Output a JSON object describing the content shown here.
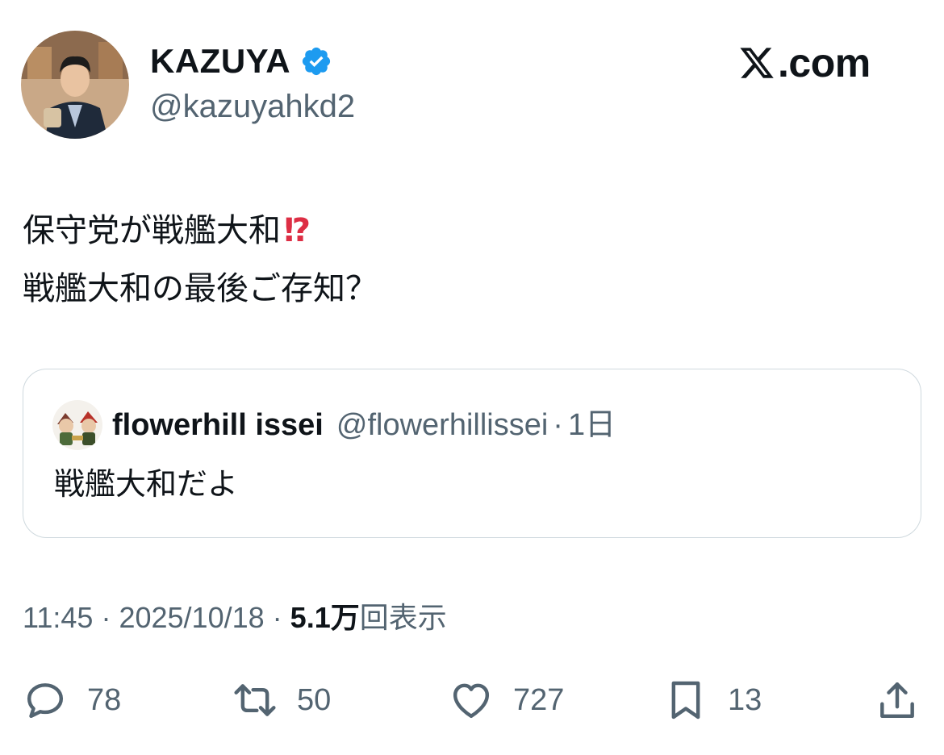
{
  "author": {
    "name": "KAZUYA",
    "handle": "@kazuyahkd2",
    "verified": true,
    "avatar_icon": "person-portrait-avatar"
  },
  "brand": {
    "logo_icon": "x-logo-icon",
    "label": ".com"
  },
  "tweet": {
    "line1": "保守党が戦艦大和",
    "line1_emoji": "⁉",
    "line2": "戦艦大和の最後ご存知？"
  },
  "quote": {
    "name": "flowerhill issei",
    "handle": "@flowerhillissei",
    "separator": "·",
    "time": "1日",
    "text": "戦艦大和だよ",
    "avatar_icon": "character-pair-avatar"
  },
  "meta": {
    "time": "11:45",
    "sep1": "·",
    "date": "2025/10/18",
    "sep2": "·",
    "views_count": "5.1万",
    "views_label": "回表示"
  },
  "actions": {
    "replies": "78",
    "reposts": "50",
    "likes": "727",
    "bookmarks": "13"
  },
  "colors": {
    "text": "#0f1419",
    "secondary": "#536471",
    "verified": "#1d9bf0",
    "border": "#cfd9de"
  }
}
